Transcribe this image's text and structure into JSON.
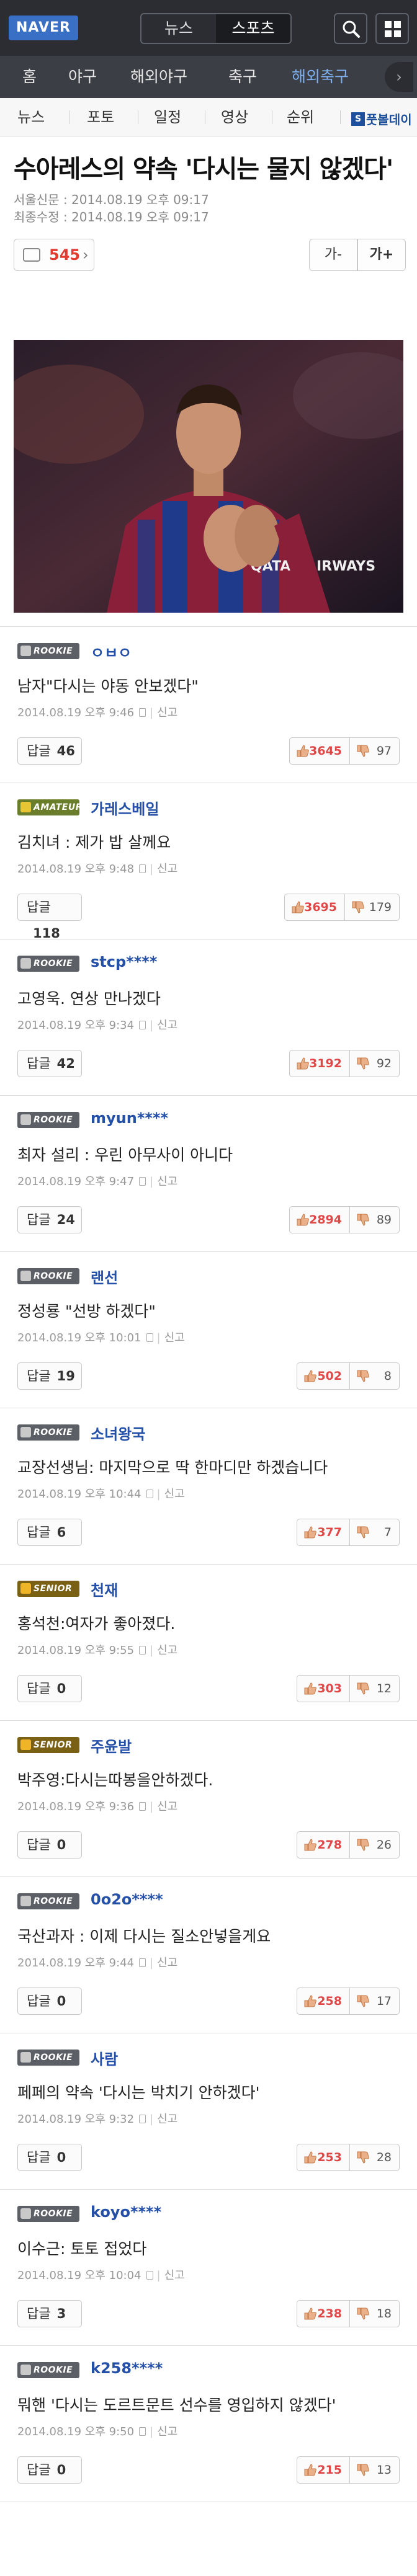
{
  "topbar": {
    "logo": "NAVER",
    "tabs": [
      "뉴스",
      "스포츠"
    ],
    "active_tab": "스포츠"
  },
  "categories": [
    "홈",
    "야구",
    "해외야구",
    "축구",
    "해외축구"
  ],
  "active_category": "해외축구",
  "subnav": {
    "items": [
      "뉴스",
      "포토",
      "일정",
      "영상",
      "순위"
    ],
    "brand_mark": "S",
    "brand": "풋볼데이"
  },
  "article": {
    "title": "수아레스의 약속 '다시는 물지 않겠다'",
    "published": "서울신문 : 2014.08.19 오후 09:17",
    "modified": "최종수정 : 2014.08.19 오후 09:17",
    "reply_count": "545",
    "font_minus": "가-",
    "font_plus": "가+",
    "photo_jersey": "QATAR AIRWAYS"
  },
  "labels": {
    "reply": "답글",
    "report": "신고"
  },
  "comments": [
    {
      "badge": "ROOKIE",
      "nick": "ㅇㅂㅇ",
      "text": "남자\"다시는 야동 안보겠다\"",
      "date": "2014.08.19 오후 9:46",
      "replies": "46",
      "likes": "3645",
      "dislikes": "97"
    },
    {
      "badge": "AMATEUR",
      "nick": "가레스베일",
      "text": "김치녀 : 제가 밥 살께요",
      "date": "2014.08.19 오후 9:48",
      "replies": "118",
      "likes": "3695",
      "dislikes": "179"
    },
    {
      "badge": "ROOKIE",
      "nick": "stcp****",
      "text": "고영욱. 연상 만나겠다",
      "date": "2014.08.19 오후 9:34",
      "replies": "42",
      "likes": "3192",
      "dislikes": "92"
    },
    {
      "badge": "ROOKIE",
      "nick": "myun****",
      "text": "최자 설리 : 우린 아무사이 아니다",
      "date": "2014.08.19 오후 9:47",
      "replies": "24",
      "likes": "2894",
      "dislikes": "89"
    },
    {
      "badge": "ROOKIE",
      "nick": "랜선",
      "text": "정성룡 \"선방 하겠다\"",
      "date": "2014.08.19 오후 10:01",
      "replies": "19",
      "likes": "502",
      "dislikes": "8"
    },
    {
      "badge": "ROOKIE",
      "nick": "소녀왕국",
      "text": "교장선생님: 마지막으로 딱 한마디만 하겠습니다",
      "date": "2014.08.19 오후 10:44",
      "replies": "6",
      "likes": "377",
      "dislikes": "7"
    },
    {
      "badge": "SENIOR",
      "nick": "천재",
      "text": "홍석천:여자가 좋아졌다.",
      "date": "2014.08.19 오후 9:55",
      "replies": "0",
      "likes": "303",
      "dislikes": "12"
    },
    {
      "badge": "SENIOR",
      "nick": "주윤발",
      "text": "박주영:다시는따봉을안하겠다.",
      "date": "2014.08.19 오후 9:36",
      "replies": "0",
      "likes": "278",
      "dislikes": "26"
    },
    {
      "badge": "ROOKIE",
      "nick": "0o2o****",
      "text": "국산과자 : 이제 다시는 질소안넣을게요",
      "date": "2014.08.19 오후 9:44",
      "replies": "0",
      "likes": "258",
      "dislikes": "17"
    },
    {
      "badge": "ROOKIE",
      "nick": "사람",
      "text": "페페의 약속 '다시는 박치기 안하겠다'",
      "date": "2014.08.19 오후 9:32",
      "replies": "0",
      "likes": "253",
      "dislikes": "28"
    },
    {
      "badge": "ROOKIE",
      "nick": "koyo****",
      "text": "이수근: 토토 접었다",
      "date": "2014.08.19 오후 10:04",
      "replies": "3",
      "likes": "238",
      "dislikes": "18"
    },
    {
      "badge": "ROOKIE",
      "nick": "k258****",
      "text": "뭐핸 '다시는 도르트문트 선수를 영입하지 않겠다'",
      "date": "2014.08.19 오후 9:50",
      "replies": "0",
      "likes": "215",
      "dislikes": "13"
    }
  ]
}
